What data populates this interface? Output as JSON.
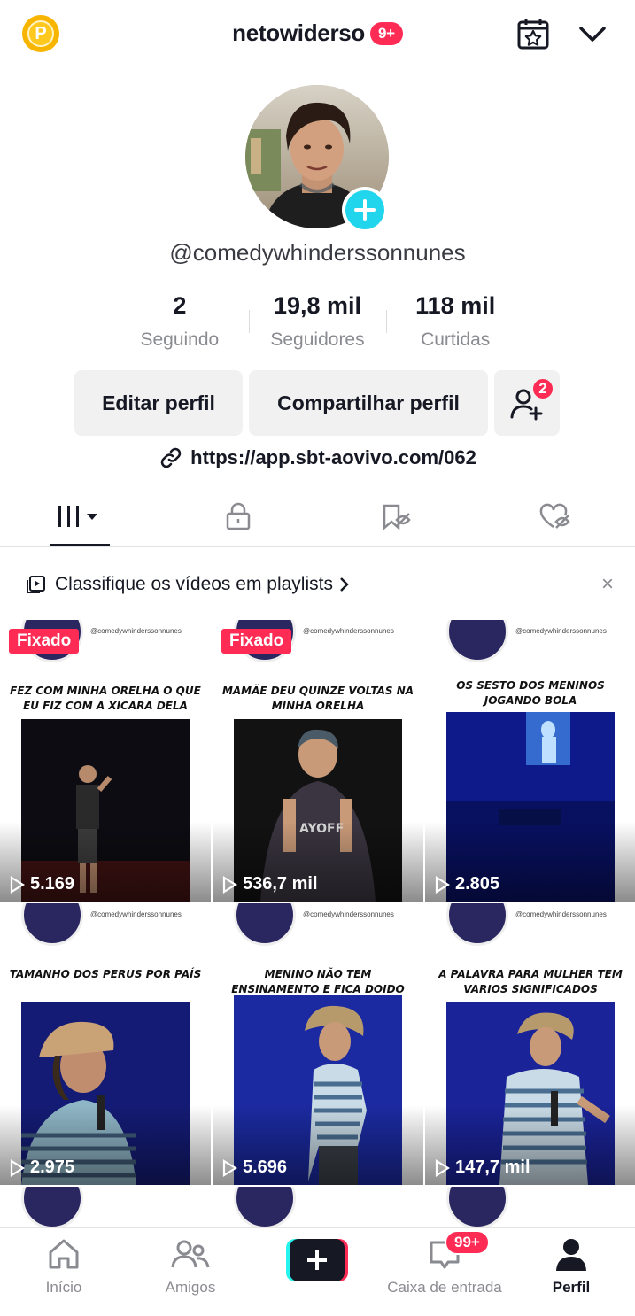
{
  "header": {
    "username": "netowiderso",
    "notification_badge": "9+",
    "coin_letter": "P"
  },
  "profile": {
    "handle": "@comedywhinderssonnunes",
    "stats": [
      {
        "value": "2",
        "label": "Seguindo"
      },
      {
        "value": "19,8 mil",
        "label": "Seguidores"
      },
      {
        "value": "118 mil",
        "label": "Curtidas"
      }
    ],
    "buttons": {
      "edit": "Editar perfil",
      "share": "Compartilhar perfil",
      "friend_badge": "2"
    },
    "link": "https://app.sbt-aovivo.com/062"
  },
  "tabs": [
    {
      "name": "videos",
      "icon": "grid-icon"
    },
    {
      "name": "private",
      "icon": "lock-icon"
    },
    {
      "name": "saved",
      "icon": "bookmark-hidden-icon"
    },
    {
      "name": "liked",
      "icon": "heart-hidden-icon"
    }
  ],
  "playlist_banner": {
    "text": "Classifique os vídeos em playlists",
    "close": "×"
  },
  "videos": [
    {
      "caption": "FEZ COM MINHA ORELHA O QUE EU FIZ COM A XICARA DELA",
      "views": "5.169",
      "pinned": "Fixado",
      "handle": "@comedywhinderssonnunes"
    },
    {
      "caption": "MAMÃE DEU QUINZE VOLTAS NA MINHA ORELHA",
      "views": "536,7 mil",
      "pinned": "Fixado",
      "handle": "@comedywhinderssonnunes"
    },
    {
      "caption": "OS SESTO DOS MENINOS JOGANDO BOLA",
      "views": "2.805",
      "pinned": "",
      "handle": "@comedywhinderssonnunes"
    },
    {
      "caption": "TAMANHO DOS PERUS POR PAÍS",
      "views": "2.975",
      "pinned": "",
      "handle": "@comedywhinderssonnunes"
    },
    {
      "caption": "MENINO NÃO TEM ENSINAMENTO E FICA DOIDO QUANDO CRESCE",
      "views": "5.696",
      "pinned": "",
      "handle": "@comedywhinderssonnunes"
    },
    {
      "caption": "A PALAVRA PARA MULHER TEM VARIOS SIGNIFICADOS",
      "views": "147,7 mil",
      "pinned": "",
      "handle": "@comedywhinderssonnunes"
    }
  ],
  "nav": {
    "home": "Início",
    "friends": "Amigos",
    "inbox": "Caixa de entrada",
    "inbox_badge": "99+",
    "profile": "Perfil"
  },
  "colors": {
    "accent_red": "#fe2c55",
    "accent_cyan": "#20d5ec",
    "text_primary": "#161823",
    "text_secondary": "#8a8b91"
  }
}
